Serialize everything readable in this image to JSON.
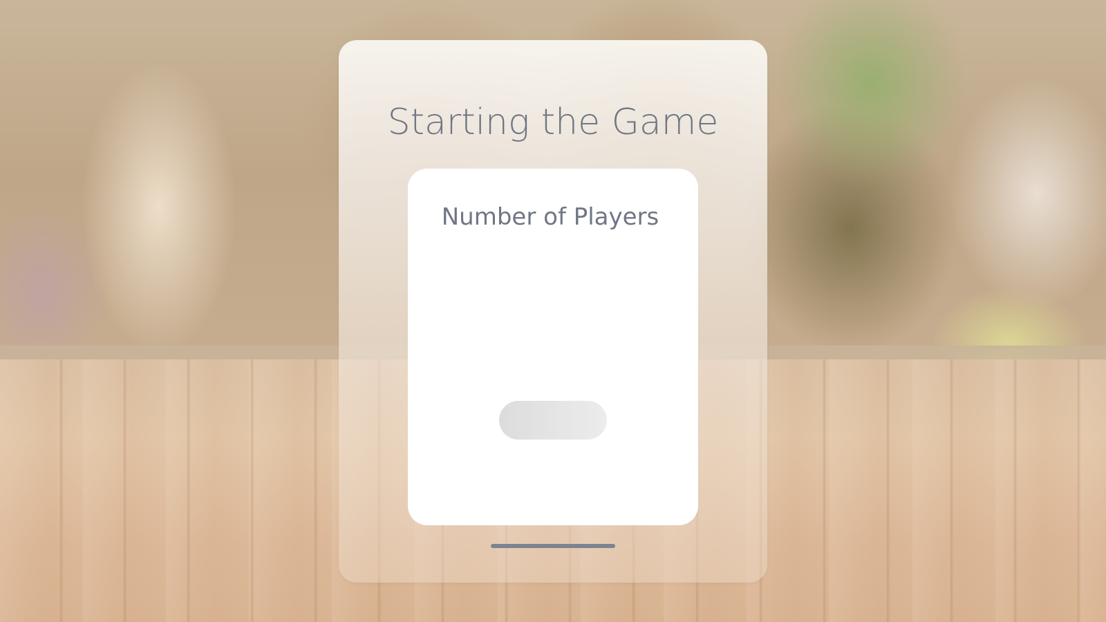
{
  "window": {
    "title": "Starting the Game"
  },
  "card": {
    "label": "Number of Players",
    "button_label": ""
  }
}
